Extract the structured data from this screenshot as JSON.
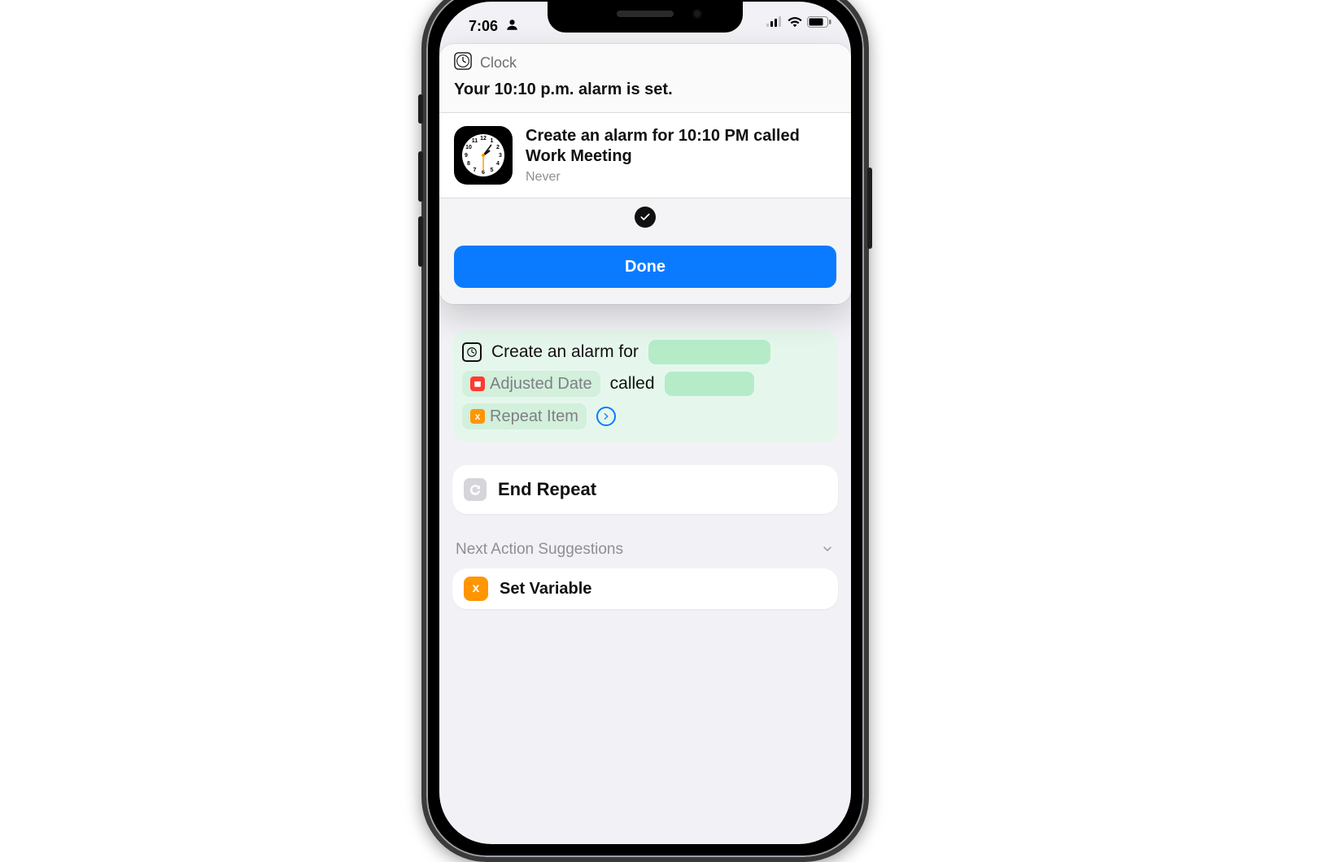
{
  "status": {
    "time": "7:06"
  },
  "notification": {
    "app_name": "Clock",
    "message": "Your 10:10 p.m. alarm is set.",
    "alarm_title": "Create an alarm for 10:10 PM called Work Meeting",
    "alarm_sub": "Never",
    "done_label": "Done"
  },
  "action": {
    "prefix": "Create an alarm for",
    "token_date": "Adjusted Date",
    "middle": "called",
    "token_repeat": "Repeat Item"
  },
  "end_repeat": {
    "label": "End Repeat"
  },
  "suggestions": {
    "header": "Next Action Suggestions",
    "item1": "Set Variable"
  }
}
